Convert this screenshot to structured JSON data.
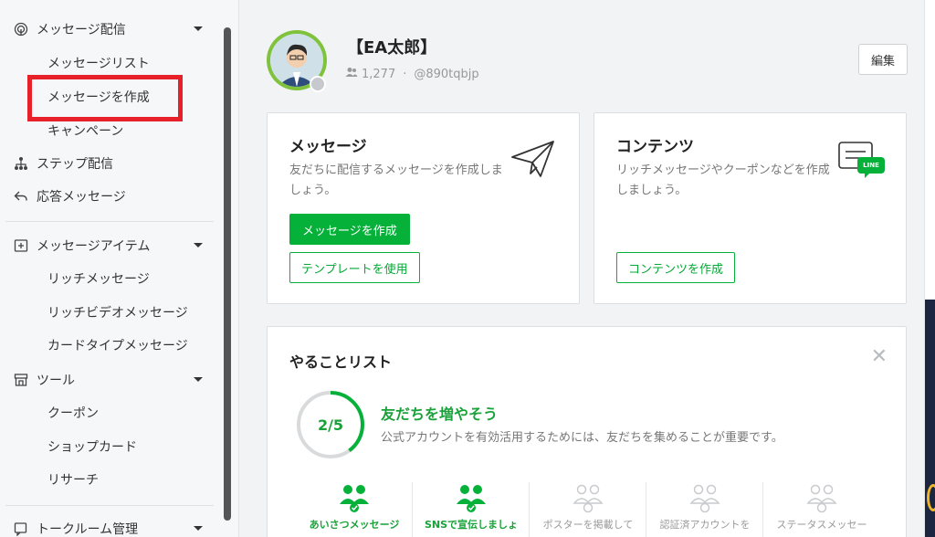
{
  "sidebar": {
    "groups": [
      {
        "label": "メッセージ配信",
        "icon": "broadcast-icon"
      },
      {
        "label": "ステップ配信",
        "icon": "step-tree-icon"
      },
      {
        "label": "応答メッセージ",
        "icon": "reply-arrow-icon"
      },
      {
        "label": "メッセージアイテム",
        "icon": "plus-box-icon"
      },
      {
        "label": "ツール",
        "icon": "shop-tool-icon"
      },
      {
        "label": "トークルーム管理",
        "icon": "chat-manage-icon"
      }
    ],
    "message_items": [
      "メッセージリスト",
      "メッセージを作成",
      "キャンペーン"
    ],
    "item_items": [
      "リッチメッセージ",
      "リッチビデオメッセージ",
      "カードタイプメッセージ"
    ],
    "tool_items": [
      "クーポン",
      "ショップカード",
      "リサーチ"
    ]
  },
  "account": {
    "name": "【EA太郎】",
    "friends": "1,277",
    "separator": "·",
    "id": "@890tqbjp",
    "edit_label": "編集"
  },
  "message_card": {
    "title": "メッセージ",
    "desc": "友だちに配信するメッセージを作成しましょう。",
    "primary_label": "メッセージを作成",
    "secondary_label": "テンプレートを使用"
  },
  "content_card": {
    "title": "コンテンツ",
    "desc": "リッチメッセージやクーポンなどを作成しましょう。",
    "button_label": "コンテンツを作成",
    "badge": "LINE"
  },
  "todo": {
    "title": "やることリスト",
    "progress_text": "2/5",
    "progress_fraction": 0.4,
    "heading": "友だちを増やそう",
    "subtext": "公式アカウントを有効活用するためには、友だちを集めることが重要です。",
    "tasks": [
      {
        "label": "あいさつメッセージ",
        "done": true
      },
      {
        "label": "SNSで宣伝しましょ",
        "done": true
      },
      {
        "label": "ポスターを掲載して",
        "done": false
      },
      {
        "label": "認証済アカウントを",
        "done": false
      },
      {
        "label": "ステータスメッセー",
        "done": false
      }
    ]
  },
  "colors": {
    "accent": "#06b13a",
    "highlight": "#e8202a"
  }
}
